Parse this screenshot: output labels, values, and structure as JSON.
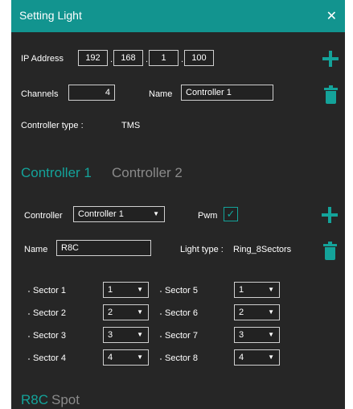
{
  "window": {
    "title": "Setting Light"
  },
  "ip": {
    "label": "IP Address",
    "octets": [
      "192",
      "168",
      "1",
      "100"
    ]
  },
  "channels": {
    "label": "Channels",
    "value": "4"
  },
  "name": {
    "label": "Name",
    "value": "Controller 1"
  },
  "controller_type": {
    "label": "Controller type :",
    "value": "TMS"
  },
  "controller_tabs": [
    "Controller 1",
    "Controller 2"
  ],
  "controller": {
    "label": "Controller",
    "selected": "Controller 1"
  },
  "pwm": {
    "label": "Pwm",
    "checked": true
  },
  "light": {
    "name_label": "Name",
    "name_value": "R8C",
    "type_label": "Light type :",
    "type_value": "Ring_8Sectors"
  },
  "sectors": [
    {
      "label": "Sector 1",
      "value": "1"
    },
    {
      "label": "Sector 2",
      "value": "2"
    },
    {
      "label": "Sector 3",
      "value": "3"
    },
    {
      "label": "Sector 4",
      "value": "4"
    },
    {
      "label": "Sector 5",
      "value": "1"
    },
    {
      "label": "Sector 6",
      "value": "2"
    },
    {
      "label": "Sector 7",
      "value": "3"
    },
    {
      "label": "Sector 8",
      "value": "4"
    }
  ],
  "light_tabs": [
    "R8C",
    "Spot"
  ],
  "colors": {
    "accent": "#14a39a",
    "titlebar": "#12948f",
    "background": "#262626"
  },
  "icons": {
    "close": "close-icon",
    "add": "plus-icon",
    "delete": "trash-icon",
    "dropdown": "chevron-down-icon",
    "check": "checkmark-icon"
  }
}
